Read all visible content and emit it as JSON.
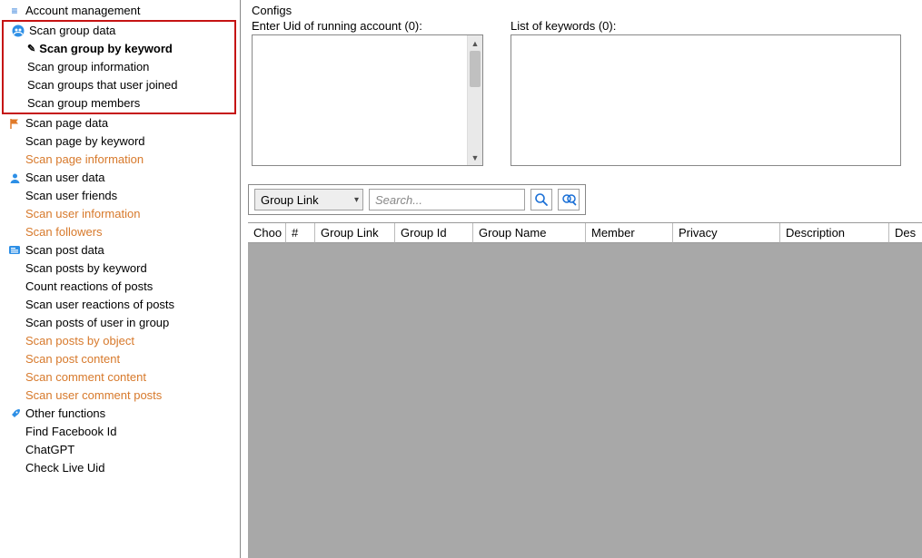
{
  "sidebar": {
    "root": "Account management",
    "group_section": {
      "title": "Scan group data",
      "by_keyword": "Scan group by keyword",
      "information": "Scan group information",
      "user_joined": "Scan groups that user joined",
      "members": "Scan group members"
    },
    "page_section": {
      "title": "Scan page data",
      "by_keyword": "Scan page by keyword",
      "information": "Scan page information"
    },
    "user_section": {
      "title": "Scan user data",
      "friends": "Scan user friends",
      "information": "Scan user information",
      "followers": "Scan followers"
    },
    "post_section": {
      "title": "Scan post data",
      "by_keyword": "Scan posts by keyword",
      "count_reactions": "Count reactions of posts",
      "user_reactions": "Scan user reactions of posts",
      "posts_in_group": "Scan posts of user in group",
      "by_object": "Scan posts by object",
      "post_content": "Scan post content",
      "comment_content": "Scan comment content",
      "user_comment_posts": "Scan user comment posts"
    },
    "other_section": {
      "title": "Other functions",
      "find_fb_id": "Find Facebook Id",
      "chatgpt": "ChatGPT",
      "check_live_uid": "Check Live Uid"
    }
  },
  "main": {
    "configs_title": "Configs",
    "uid_label": "Enter Uid of running account (0):",
    "keywords_label": "List of keywords (0):",
    "dropdown_value": "Group Link",
    "search_placeholder": "Search...",
    "columns": [
      "Choo",
      "#",
      "Group Link",
      "Group Id",
      "Group Name",
      "Member",
      "Privacy",
      "Description",
      "Des"
    ]
  }
}
